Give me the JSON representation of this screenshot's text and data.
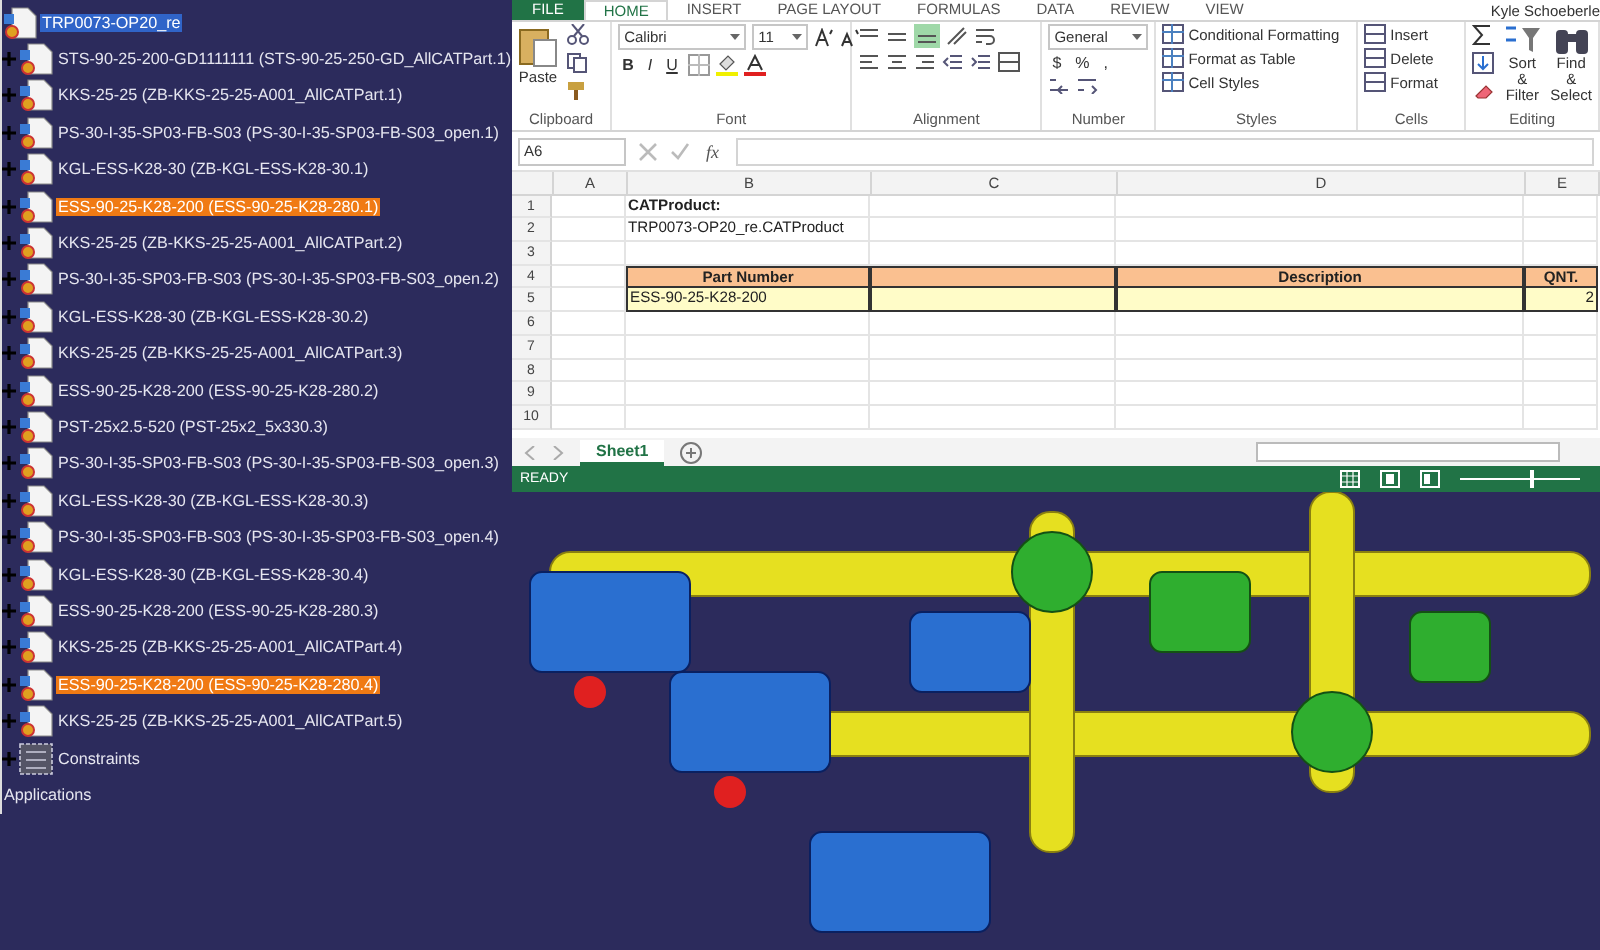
{
  "tree": [
    {
      "label": "TRP0073-OP20_re",
      "kind": "product",
      "selected": true,
      "highlighted": false,
      "children": [
        {
          "label": "STS-90-25-200-GD1111111 (STS-90-25-250-GD_AllCATPart.1)",
          "kind": "part",
          "selected": false,
          "highlighted": false
        },
        {
          "label": "KKS-25-25 (ZB-KKS-25-25-A001_AllCATPart.1)",
          "kind": "part",
          "selected": false,
          "highlighted": false
        },
        {
          "label": "PS-30-I-35-SP03-FB-S03 (PS-30-I-35-SP03-FB-S03_open.1)",
          "kind": "part",
          "selected": false,
          "highlighted": false
        },
        {
          "label": "KGL-ESS-K28-30 (ZB-KGL-ESS-K28-30.1)",
          "kind": "part",
          "selected": false,
          "highlighted": false
        },
        {
          "label": "ESS-90-25-K28-200 (ESS-90-25-K28-280.1)",
          "kind": "part",
          "selected": false,
          "highlighted": true
        },
        {
          "label": "KKS-25-25 (ZB-KKS-25-25-A001_AllCATPart.2)",
          "kind": "part",
          "selected": false,
          "highlighted": false
        },
        {
          "label": "PS-30-I-35-SP03-FB-S03 (PS-30-I-35-SP03-FB-S03_open.2)",
          "kind": "part",
          "selected": false,
          "highlighted": false
        },
        {
          "label": "KGL-ESS-K28-30 (ZB-KGL-ESS-K28-30.2)",
          "kind": "part",
          "selected": false,
          "highlighted": false
        },
        {
          "label": "KKS-25-25 (ZB-KKS-25-25-A001_AllCATPart.3)",
          "kind": "part",
          "selected": false,
          "highlighted": false
        },
        {
          "label": "ESS-90-25-K28-200 (ESS-90-25-K28-280.2)",
          "kind": "part",
          "selected": false,
          "highlighted": false
        },
        {
          "label": "PST-25x2.5-520 (PST-25x2_5x330.3)",
          "kind": "part",
          "selected": false,
          "highlighted": false
        },
        {
          "label": "PS-30-I-35-SP03-FB-S03 (PS-30-I-35-SP03-FB-S03_open.3)",
          "kind": "part",
          "selected": false,
          "highlighted": false
        },
        {
          "label": "KGL-ESS-K28-30 (ZB-KGL-ESS-K28-30.3)",
          "kind": "part",
          "selected": false,
          "highlighted": false
        },
        {
          "label": "PS-30-I-35-SP03-FB-S03 (PS-30-I-35-SP03-FB-S03_open.4)",
          "kind": "part",
          "selected": false,
          "highlighted": false
        },
        {
          "label": "KGL-ESS-K28-30 (ZB-KGL-ESS-K28-30.4)",
          "kind": "part",
          "selected": false,
          "highlighted": false
        },
        {
          "label": "ESS-90-25-K28-200 (ESS-90-25-K28-280.3)",
          "kind": "part",
          "selected": false,
          "highlighted": false
        },
        {
          "label": "KKS-25-25 (ZB-KKS-25-25-A001_AllCATPart.4)",
          "kind": "part",
          "selected": false,
          "highlighted": false
        },
        {
          "label": "ESS-90-25-K28-200 (ESS-90-25-K28-280.4)",
          "kind": "part",
          "selected": false,
          "highlighted": true
        },
        {
          "label": "KKS-25-25 (ZB-KKS-25-25-A001_AllCATPart.5)",
          "kind": "part",
          "selected": false,
          "highlighted": false
        },
        {
          "label": "Constraints",
          "kind": "constraints",
          "selected": false,
          "highlighted": false
        }
      ]
    },
    {
      "label": "Applications",
      "kind": "application",
      "selected": false,
      "highlighted": false
    }
  ],
  "excel": {
    "ribbon_tabs": [
      {
        "label": "FILE",
        "kind": "file",
        "selected": false
      },
      {
        "label": "HOME",
        "kind": "tab",
        "selected": true
      },
      {
        "label": "INSERT",
        "kind": "tab",
        "selected": false
      },
      {
        "label": "PAGE LAYOUT",
        "kind": "tab",
        "selected": false
      },
      {
        "label": "FORMULAS",
        "kind": "tab",
        "selected": false
      },
      {
        "label": "DATA",
        "kind": "tab",
        "selected": false
      },
      {
        "label": "REVIEW",
        "kind": "tab",
        "selected": false
      },
      {
        "label": "VIEW",
        "kind": "tab",
        "selected": false
      }
    ],
    "user": "Kyle Schoeberle",
    "paste_label": "Paste",
    "font_name": "Calibri",
    "font_size": "11",
    "font_buttons": [
      "B",
      "I",
      "U"
    ],
    "number_format": "General",
    "number_buttons": [
      "$",
      "%",
      ","
    ],
    "styles_buttons": [
      "Conditional Formatting",
      "Format as Table",
      "Cell Styles"
    ],
    "cells_buttons": [
      "Insert",
      "Delete",
      "Format"
    ],
    "editing_buttons": [
      [
        "Sort &",
        "Filter"
      ],
      [
        "Find &",
        "Select"
      ]
    ],
    "group_labels": [
      "Clipboard",
      "Font",
      "Alignment",
      "Number",
      "Styles",
      "Cells",
      "Editing"
    ],
    "name_box": "A6",
    "function_label": "fx",
    "columns": [
      "A",
      "B",
      "C",
      "D",
      "E"
    ],
    "rows": [
      {
        "number": "1",
        "kind": "title",
        "cells": [
          "",
          "CATProduct:",
          "",
          "",
          ""
        ]
      },
      {
        "number": "2",
        "kind": "plain",
        "cells": [
          "",
          "TRP0073-OP20_re.CATProduct",
          "",
          "",
          ""
        ]
      },
      {
        "number": "3",
        "kind": "plain",
        "cells": [
          "",
          "",
          "",
          "",
          ""
        ]
      },
      {
        "number": "4",
        "kind": "header",
        "cells": [
          "",
          "Part Number",
          "",
          "Description",
          "QNT."
        ]
      },
      {
        "number": "5",
        "kind": "data",
        "cells": [
          "",
          "ESS-90-25-K28-200",
          "",
          "",
          "2"
        ]
      },
      {
        "number": "6",
        "kind": "plain",
        "cells": [
          "",
          "",
          "",
          "",
          ""
        ]
      },
      {
        "number": "7",
        "kind": "plain",
        "cells": [
          "",
          "",
          "",
          "",
          ""
        ]
      },
      {
        "number": "8",
        "kind": "plain",
        "cells": [
          "",
          "",
          "",
          "",
          ""
        ]
      },
      {
        "number": "9",
        "kind": "plain",
        "cells": [
          "",
          "",
          "",
          "",
          ""
        ]
      },
      {
        "number": "10",
        "kind": "plain",
        "cells": [
          "",
          "",
          "",
          "",
          ""
        ]
      }
    ],
    "sheet_tabs": [
      {
        "label": "Sheet1",
        "selected": true
      }
    ],
    "status": "READY",
    "zoom": {
      "level": 0.6
    }
  }
}
